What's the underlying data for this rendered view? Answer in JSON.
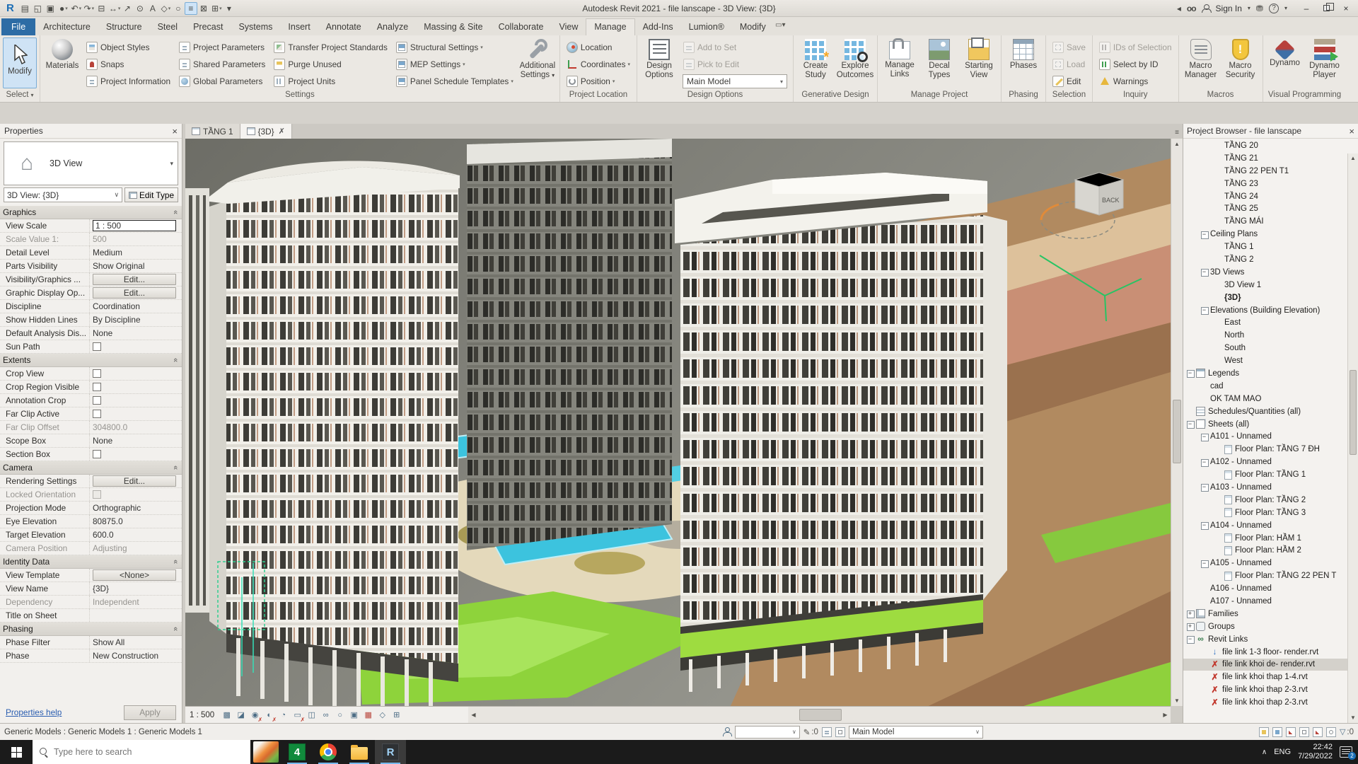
{
  "title_bar": {
    "logo": "R",
    "title": "Autodesk Revit 2021 - file lanscape - 3D View: {3D}",
    "sign_in": "Sign In",
    "qat": [
      {
        "g": "▤"
      },
      {
        "g": "◱"
      },
      {
        "g": "▣"
      },
      {
        "g": "●",
        "dd": "▾"
      },
      {
        "g": "↶",
        "dd": "▾"
      },
      {
        "g": "↷",
        "dd": "▾"
      },
      {
        "g": "⊟"
      },
      {
        "g": "↔",
        "dd": "▾"
      },
      {
        "g": "↗"
      },
      {
        "g": "⊙"
      },
      {
        "g": "A"
      },
      {
        "g": "◇",
        "dd": "▾"
      },
      {
        "g": "○"
      },
      {
        "g": "≡",
        "cls": "on"
      },
      {
        "g": "⊠"
      },
      {
        "g": "⊞",
        "dd": "▾"
      },
      {
        "g": "▾"
      }
    ]
  },
  "tabs": [
    {
      "label": "File",
      "cls": "file"
    },
    {
      "label": "Architecture"
    },
    {
      "label": "Structure"
    },
    {
      "label": "Steel"
    },
    {
      "label": "Precast"
    },
    {
      "label": "Systems"
    },
    {
      "label": "Insert"
    },
    {
      "label": "Annotate"
    },
    {
      "label": "Analyze"
    },
    {
      "label": "Massing & Site"
    },
    {
      "label": "Collaborate"
    },
    {
      "label": "View"
    },
    {
      "label": "Manage",
      "cls": "active"
    },
    {
      "label": "Add-Ins"
    },
    {
      "label": "Lumion®"
    },
    {
      "label": "Modify"
    }
  ],
  "ribbon": {
    "modify_label": "Modify",
    "materials_label": "Materials",
    "additional_l1": "Additional",
    "additional_l2": "Settings",
    "design_l1": "Design",
    "design_l2": "Options",
    "design_combo": "Main Model",
    "phases_label": "Phases",
    "settings_col1": [
      {
        "label": "Object Styles",
        "cls": "icA"
      },
      {
        "label": "Snaps",
        "cls": "icB"
      },
      {
        "label": "Project Information",
        "cls": "icC"
      }
    ],
    "settings_col2": [
      {
        "label": "Project Parameters",
        "cls": "icC"
      },
      {
        "label": "Shared Parameters",
        "cls": "icC"
      },
      {
        "label": "Global Parameters",
        "cls": "icD"
      }
    ],
    "settings_col3": [
      {
        "label": "Transfer Project Standards",
        "cls": "icE"
      },
      {
        "label": "Purge Unused",
        "cls": "icF"
      },
      {
        "label": "Project Units",
        "cls": "icG"
      }
    ],
    "settings_col4": [
      {
        "label": "Structural Settings",
        "cls": "icH dd"
      },
      {
        "label": "MEP Settings",
        "cls": "icH dd"
      },
      {
        "label": "Panel Schedule Templates",
        "cls": "icH dd"
      }
    ],
    "location_items": [
      {
        "label": "Location",
        "cls": "icLoc"
      },
      {
        "label": "Coordinates",
        "cls": "icCoord dd"
      },
      {
        "label": "Position",
        "cls": "icPos dd"
      }
    ],
    "design_items": [
      {
        "label": "Add to Set",
        "cls": "icAdd dis"
      },
      {
        "label": "Pick to Edit",
        "cls": "icPick dis"
      }
    ],
    "generative_items": [
      {
        "l1": "Create",
        "l2": "Study",
        "icon": "bGrid"
      },
      {
        "l1": "Explore",
        "l2": "Outcomes",
        "icon": "bGridZ"
      }
    ],
    "manageproject_items": [
      {
        "l1": "Manage",
        "l2": "Links",
        "icon": "bLinks"
      },
      {
        "l1": "Decal",
        "l2": "Types",
        "icon": "bDecal"
      },
      {
        "l1": "Starting",
        "l2": "View",
        "icon": "bStart"
      }
    ],
    "selection_items": [
      {
        "label": "Save",
        "cls": "icSave dis"
      },
      {
        "label": "Load",
        "cls": "icLoad dis"
      },
      {
        "label": "Edit",
        "cls": "icEdit"
      }
    ],
    "inquiry_items": [
      {
        "label": "IDs of Selection",
        "cls": "icIds dis"
      },
      {
        "label": "Select by ID",
        "cls": "icSel"
      },
      {
        "label": "Warnings",
        "cls": "icWarn"
      }
    ],
    "macro_items": [
      {
        "l1": "Macro",
        "l2": "Manager",
        "icon": "bScroll"
      },
      {
        "l1": "Macro",
        "l2": "Security",
        "icon": "bShield"
      }
    ],
    "visual_items": [
      {
        "l1": "Dynamo",
        "l2": "",
        "icon": "bDynamo"
      },
      {
        "l1": "Dynamo",
        "l2": "Player",
        "icon": "bPlayer"
      }
    ],
    "panels": {
      "select": "Select",
      "settings": "Settings",
      "location": "Project Location",
      "design": "Design Options",
      "generative": "Generative Design",
      "manage": "Manage Project",
      "phasing": "Phasing",
      "selection": "Selection",
      "inquiry": "Inquiry",
      "macros": "Macros",
      "visual": "Visual Programming"
    }
  },
  "view_tabs": [
    {
      "label": "TẦNG 1",
      "cls": "",
      "icon": "plan"
    },
    {
      "label": "{3D}",
      "cls": "active",
      "icon": "house"
    }
  ],
  "properties": {
    "title": "Properties",
    "type_label": "3D View",
    "instance_combo": "3D View: {3D}",
    "edit_type_label": "Edit Type",
    "help_label": "Properties help",
    "apply_label": "Apply",
    "rows": [
      {
        "cls": "sec",
        "label": "Graphics"
      },
      {
        "cls": "t-input",
        "label": "View Scale",
        "value": "1 : 500"
      },
      {
        "cls": "t-text dis",
        "label": "Scale Value    1:",
        "value": "500"
      },
      {
        "cls": "t-text",
        "label": "Detail Level",
        "value": "Medium"
      },
      {
        "cls": "t-text",
        "label": "Parts Visibility",
        "value": "Show Original"
      },
      {
        "cls": "t-btn",
        "label": "Visibility/Graphics ...",
        "value": "Edit..."
      },
      {
        "cls": "t-btn",
        "label": "Graphic Display Op...",
        "value": "Edit..."
      },
      {
        "cls": "t-text",
        "label": "Discipline",
        "value": "Coordination"
      },
      {
        "cls": "t-text",
        "label": "Show Hidden Lines",
        "value": "By Discipline"
      },
      {
        "cls": "t-text",
        "label": "Default Analysis Dis...",
        "value": "None"
      },
      {
        "cls": "t-check",
        "label": "Sun Path",
        "value": ""
      },
      {
        "cls": "sec",
        "label": "Extents"
      },
      {
        "cls": "t-check",
        "label": "Crop View",
        "value": ""
      },
      {
        "cls": "t-check",
        "label": "Crop Region Visible",
        "value": ""
      },
      {
        "cls": "t-check",
        "label": "Annotation Crop",
        "value": ""
      },
      {
        "cls": "t-check",
        "label": "Far Clip Active",
        "value": ""
      },
      {
        "cls": "t-text dis",
        "label": "Far Clip Offset",
        "value": "304800.0"
      },
      {
        "cls": "t-text",
        "label": "Scope Box",
        "value": "None"
      },
      {
        "cls": "t-check",
        "label": "Section Box",
        "value": ""
      },
      {
        "cls": "sec",
        "label": "Camera"
      },
      {
        "cls": "t-btn",
        "label": "Rendering Settings",
        "value": "Edit..."
      },
      {
        "cls": "t-check dis",
        "label": "Locked Orientation",
        "value": ""
      },
      {
        "cls": "t-text",
        "label": "Projection Mode",
        "value": "Orthographic"
      },
      {
        "cls": "t-text",
        "label": "Eye Elevation",
        "value": "80875.0"
      },
      {
        "cls": "t-text",
        "label": "Target Elevation",
        "value": "600.0"
      },
      {
        "cls": "t-text dis",
        "label": "Camera Position",
        "value": "Adjusting"
      },
      {
        "cls": "sec",
        "label": "Identity Data"
      },
      {
        "cls": "t-btn",
        "label": "View Template",
        "value": "<None>"
      },
      {
        "cls": "t-text",
        "label": "View Name",
        "value": "{3D}"
      },
      {
        "cls": "t-text dis",
        "label": "Dependency",
        "value": "Independent"
      },
      {
        "cls": "t-text",
        "label": "Title on Sheet",
        "value": ""
      },
      {
        "cls": "sec",
        "label": "Phasing"
      },
      {
        "cls": "t-text",
        "label": "Phase Filter",
        "value": "Show All"
      },
      {
        "cls": "t-text",
        "label": "Phase",
        "value": "New Construction"
      }
    ]
  },
  "project_browser": {
    "title": "Project Browser - file lanscape",
    "rows": [
      {
        "cls": "lvl3",
        "label": "TẦNG 20"
      },
      {
        "cls": "lvl3",
        "label": "TẦNG 21"
      },
      {
        "cls": "lvl3",
        "label": "TẦNG 22 PEN T1"
      },
      {
        "cls": "lvl3",
        "label": "TẦNG 23"
      },
      {
        "cls": "lvl3",
        "label": "TẦNG 24"
      },
      {
        "cls": "lvl3",
        "label": "TẦNG 25"
      },
      {
        "cls": "lvl3",
        "label": "TẦNG MÁI"
      },
      {
        "cls": "lvl2",
        "exp": "minus",
        "label": "Ceiling Plans"
      },
      {
        "cls": "lvl3",
        "label": "TẦNG 1"
      },
      {
        "cls": "lvl3",
        "label": "TẦNG 2"
      },
      {
        "cls": "lvl2",
        "exp": "minus",
        "label": "3D Views"
      },
      {
        "cls": "lvl3",
        "label": "3D View 1"
      },
      {
        "cls": "lvl3 bold",
        "label": "{3D}"
      },
      {
        "cls": "lvl2",
        "exp": "minus",
        "label": "Elevations (Building Elevation)"
      },
      {
        "cls": "lvl3",
        "label": "East"
      },
      {
        "cls": "lvl3",
        "label": "North"
      },
      {
        "cls": "lvl3",
        "label": "South"
      },
      {
        "cls": "lvl3",
        "label": "West"
      },
      {
        "cls": "lvl1",
        "exp": "minus",
        "icon": "legend",
        "label": "Legends"
      },
      {
        "cls": "lvl2",
        "label": "cad"
      },
      {
        "cls": "lvl2",
        "label": "OK TAM MAO"
      },
      {
        "cls": "lvl1",
        "icon": "schedule",
        "label": "Schedules/Quantities (all)"
      },
      {
        "cls": "lvl1",
        "exp": "minus",
        "icon": "sheets",
        "label": "Sheets (all)"
      },
      {
        "cls": "lvl2",
        "exp": "minus",
        "label": "A101 - Unnamed"
      },
      {
        "cls": "lvl3",
        "icon": "sheet",
        "label": "Floor Plan: TẦNG 7 ĐH"
      },
      {
        "cls": "lvl2",
        "exp": "minus",
        "label": "A102 - Unnamed"
      },
      {
        "cls": "lvl3",
        "icon": "sheet",
        "label": "Floor Plan: TẦNG 1"
      },
      {
        "cls": "lvl2",
        "exp": "minus",
        "label": "A103 - Unnamed"
      },
      {
        "cls": "lvl3",
        "icon": "sheet",
        "label": "Floor Plan: TẦNG 2"
      },
      {
        "cls": "lvl3",
        "icon": "sheet",
        "label": "Floor Plan: TẦNG 3"
      },
      {
        "cls": "lvl2",
        "exp": "minus",
        "label": "A104 - Unnamed"
      },
      {
        "cls": "lvl3",
        "icon": "sheet",
        "label": "Floor Plan: HẦM 1"
      },
      {
        "cls": "lvl3",
        "icon": "sheet",
        "label": "Floor Plan: HẦM 2"
      },
      {
        "cls": "lvl2",
        "exp": "minus",
        "label": "A105 - Unnamed"
      },
      {
        "cls": "lvl3",
        "icon": "sheet",
        "label": "Floor Plan: TẦNG 22 PEN T"
      },
      {
        "cls": "lvl2",
        "label": "A106 - Unnamed"
      },
      {
        "cls": "lvl2",
        "label": "A107 - Unnamed"
      },
      {
        "cls": "lvl1",
        "exp": "plus",
        "icon": "families",
        "label": "Families"
      },
      {
        "cls": "lvl1",
        "exp": "plus",
        "icon": "groups",
        "label": "Groups"
      },
      {
        "cls": "lvl1",
        "exp": "minus",
        "icon": "links",
        "label": "Revit Links"
      },
      {
        "cls": "lvl2",
        "icon": "dlink",
        "label": "file link 1-3 floor- render.rvt"
      },
      {
        "cls": "lvl2 selected",
        "icon": "redx",
        "label": "file link khoi de- render.rvt"
      },
      {
        "cls": "lvl2",
        "icon": "redx",
        "label": "file link khoi thap 1-4.rvt"
      },
      {
        "cls": "lvl2",
        "icon": "redx",
        "label": "file link khoi thap 2-3.rvt"
      },
      {
        "cls": "lvl2",
        "icon": "redx",
        "label": "file link khoi thap 2-3.rvt"
      }
    ]
  },
  "view_control": {
    "scale": "1 : 500",
    "icons": [
      {
        "g": "▩"
      },
      {
        "g": "◪"
      },
      {
        "g": "◉",
        "cls": "off"
      },
      {
        "g": "◐",
        "cls": "off"
      },
      {
        "g": "◔"
      },
      {
        "g": "▭",
        "cls": "off"
      },
      {
        "g": "◫"
      },
      {
        "g": "∞"
      },
      {
        "g": "○"
      },
      {
        "g": "▣"
      },
      {
        "g": "▦",
        "cls": "red"
      },
      {
        "g": "◇"
      },
      {
        "g": "⊞"
      }
    ]
  },
  "viewport": {
    "viewcube_label": "BACK"
  },
  "status_bar": {
    "left_text": "Generic Models : Generic Models 1 : Generic Models 1",
    "editable_icon": "✎",
    "editable_count": ":0",
    "main_model": "Main Model",
    "filter_count": ":0"
  },
  "taskbar": {
    "search_placeholder": "Type here to search",
    "app4_label": "4",
    "revit_label": "R",
    "tray_chevron": "∧",
    "language": "ENG",
    "time": "22:42",
    "date": "7/29/2022",
    "notif_count": "2"
  }
}
